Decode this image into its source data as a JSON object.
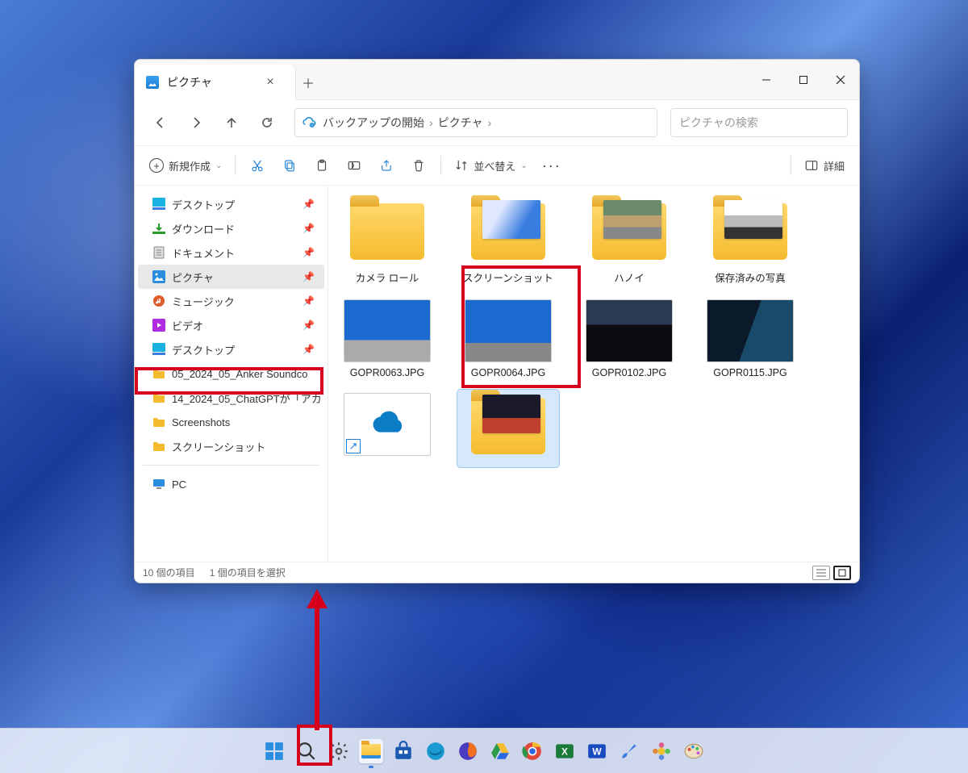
{
  "window": {
    "tab_title": "ピクチャ",
    "new_tab_tooltip": "新しいタブ"
  },
  "nav": {
    "back": "戻る",
    "forward": "進む",
    "up": "上へ",
    "refresh": "更新"
  },
  "breadcrumb": {
    "segment1": "バックアップの開始",
    "segment2": "ピクチャ"
  },
  "search": {
    "placeholder": "ピクチャの検索"
  },
  "toolbar": {
    "new_label": "新規作成",
    "cut": "切り取り",
    "copy": "コピー",
    "paste": "貼り付け",
    "rename": "名前の変更",
    "share": "共有",
    "delete": "削除",
    "sort_label": "並べ替え",
    "details_label": "詳細"
  },
  "sidebar": {
    "items": [
      {
        "label": "デスクトップ",
        "icon": "desktop",
        "pinned": true
      },
      {
        "label": "ダウンロード",
        "icon": "download",
        "pinned": true
      },
      {
        "label": "ドキュメント",
        "icon": "document",
        "pinned": true
      },
      {
        "label": "ピクチャ",
        "icon": "pictures",
        "pinned": true,
        "selected": true
      },
      {
        "label": "ミュージック",
        "icon": "music",
        "pinned": true
      },
      {
        "label": "ビデオ",
        "icon": "video",
        "pinned": true
      },
      {
        "label": "デスクトップ",
        "icon": "desktop",
        "pinned": true
      },
      {
        "label": "05_2024_05_Anker Soundco",
        "icon": "folder",
        "pinned": false
      },
      {
        "label": "14_2024_05_ChatGPTが「アカ",
        "icon": "folder",
        "pinned": false
      },
      {
        "label": "Screenshots",
        "icon": "folder",
        "pinned": false
      },
      {
        "label": "スクリーンショット",
        "icon": "folder",
        "pinned": false
      }
    ],
    "pc_label": "PC"
  },
  "content": {
    "row1": [
      {
        "label": "カメラ ロール",
        "type": "folder-empty"
      },
      {
        "label": "スクリーンショット",
        "type": "folder-preview",
        "preview": "win11",
        "highlighted": true
      },
      {
        "label": "ハノイ",
        "type": "folder-preview",
        "preview": "street"
      },
      {
        "label": "保存済みの写真",
        "type": "folder-preview",
        "preview": "car"
      }
    ],
    "row2": [
      {
        "label": "GOPR0063.JPG",
        "type": "image",
        "preview": "sky-tower1"
      },
      {
        "label": "GOPR0064.JPG",
        "type": "image",
        "preview": "sky-tower2"
      },
      {
        "label": "GOPR0102.JPG",
        "type": "image",
        "preview": "night-city"
      },
      {
        "label": "GOPR0115.JPG",
        "type": "image",
        "preview": "night-bridge"
      }
    ],
    "row3": [
      {
        "label": "",
        "type": "onedrive-link"
      },
      {
        "label": "",
        "type": "folder-preview",
        "preview": "night-tower",
        "selected": true
      }
    ]
  },
  "status": {
    "count_text": "10 個の項目",
    "selection_text": "1 個の項目を選択"
  },
  "taskbar": {
    "items": [
      "start",
      "search",
      "settings",
      "explorer",
      "store",
      "edge",
      "firefox",
      "drive",
      "chrome",
      "excel",
      "word",
      "brush",
      "flower",
      "paint"
    ]
  }
}
